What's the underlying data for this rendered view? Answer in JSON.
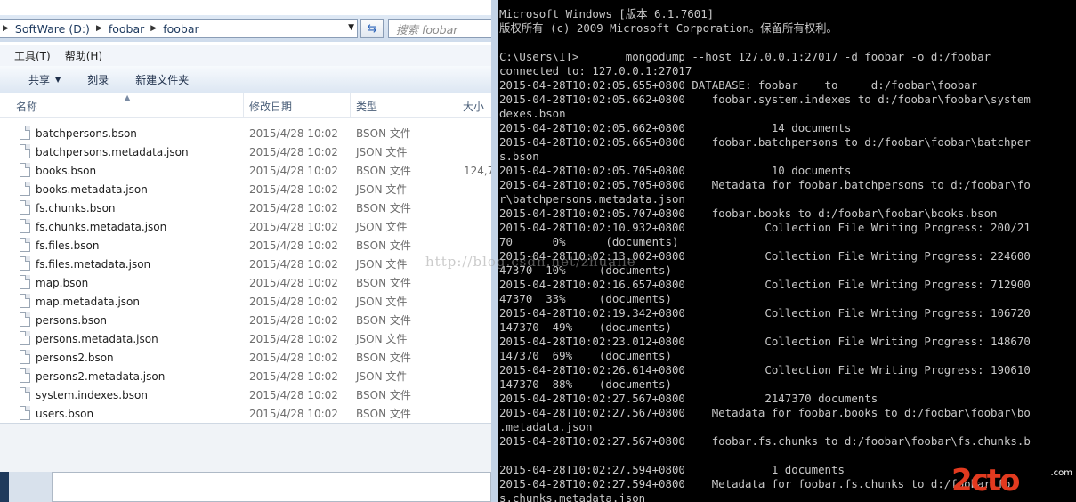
{
  "explorer": {
    "breadcrumb": [
      {
        "label": "SoftWare (D:)"
      },
      {
        "label": "foobar"
      },
      {
        "label": "foobar"
      }
    ],
    "search_placeholder": "搜索 foobar",
    "menu": [
      "工具(T)",
      "帮助(H)"
    ],
    "toolbar": {
      "share": "共享",
      "burn": "刻录",
      "new_folder": "新建文件夹"
    },
    "columns": {
      "name": "名称",
      "date": "修改日期",
      "type": "类型",
      "size": "大小"
    },
    "files": [
      {
        "name": "batchpersons.bson",
        "date": "2015/4/28 10:02",
        "type": "BSON 文件",
        "size": ""
      },
      {
        "name": "batchpersons.metadata.json",
        "date": "2015/4/28 10:02",
        "type": "JSON 文件",
        "size": ""
      },
      {
        "name": "books.bson",
        "date": "2015/4/28 10:02",
        "type": "BSON 文件",
        "size": "124,7"
      },
      {
        "name": "books.metadata.json",
        "date": "2015/4/28 10:02",
        "type": "JSON 文件",
        "size": ""
      },
      {
        "name": "fs.chunks.bson",
        "date": "2015/4/28 10:02",
        "type": "BSON 文件",
        "size": ""
      },
      {
        "name": "fs.chunks.metadata.json",
        "date": "2015/4/28 10:02",
        "type": "JSON 文件",
        "size": ""
      },
      {
        "name": "fs.files.bson",
        "date": "2015/4/28 10:02",
        "type": "BSON 文件",
        "size": ""
      },
      {
        "name": "fs.files.metadata.json",
        "date": "2015/4/28 10:02",
        "type": "JSON 文件",
        "size": ""
      },
      {
        "name": "map.bson",
        "date": "2015/4/28 10:02",
        "type": "BSON 文件",
        "size": ""
      },
      {
        "name": "map.metadata.json",
        "date": "2015/4/28 10:02",
        "type": "JSON 文件",
        "size": ""
      },
      {
        "name": "persons.bson",
        "date": "2015/4/28 10:02",
        "type": "BSON 文件",
        "size": ""
      },
      {
        "name": "persons.metadata.json",
        "date": "2015/4/28 10:02",
        "type": "JSON 文件",
        "size": ""
      },
      {
        "name": "persons2.bson",
        "date": "2015/4/28 10:02",
        "type": "BSON 文件",
        "size": ""
      },
      {
        "name": "persons2.metadata.json",
        "date": "2015/4/28 10:02",
        "type": "JSON 文件",
        "size": ""
      },
      {
        "name": "system.indexes.bson",
        "date": "2015/4/28 10:02",
        "type": "BSON 文件",
        "size": ""
      },
      {
        "name": "users.bson",
        "date": "2015/4/28 10:02",
        "type": "BSON 文件",
        "size": ""
      }
    ]
  },
  "console": {
    "lines": [
      "Microsoft Windows [版本 6.1.7601]",
      "版权所有 (c) 2009 Microsoft Corporation。保留所有权利。",
      "",
      "C:\\Users\\IT>       mongodump --host 127.0.0.1:27017 -d foobar -o d:/foobar",
      "connected to: 127.0.0.1:27017",
      "2015-04-28T10:02:05.655+0800 DATABASE: foobar    to     d:/foobar\\foobar",
      "2015-04-28T10:02:05.662+0800    foobar.system.indexes to d:/foobar\\foobar\\system",
      "dexes.bson",
      "2015-04-28T10:02:05.662+0800             14 documents",
      "2015-04-28T10:02:05.665+0800    foobar.batchpersons to d:/foobar\\foobar\\batchper",
      "s.bson",
      "2015-04-28T10:02:05.705+0800             10 documents",
      "2015-04-28T10:02:05.705+0800    Metadata for foobar.batchpersons to d:/foobar\\fo",
      "r\\batchpersons.metadata.json",
      "2015-04-28T10:02:05.707+0800    foobar.books to d:/foobar\\foobar\\books.bson",
      "2015-04-28T10:02:10.932+0800            Collection File Writing Progress: 200/21",
      "70      0%      (documents)",
      "2015-04-28T10:02:13.002+0800            Collection File Writing Progress: 224600",
      "47370  10%     (documents)",
      "2015-04-28T10:02:16.657+0800            Collection File Writing Progress: 712900",
      "47370  33%     (documents)",
      "2015-04-28T10:02:19.342+0800            Collection File Writing Progress: 106720",
      "147370  49%    (documents)",
      "2015-04-28T10:02:23.012+0800            Collection File Writing Progress: 148670",
      "147370  69%    (documents)",
      "2015-04-28T10:02:26.614+0800            Collection File Writing Progress: 190610",
      "147370  88%    (documents)",
      "2015-04-28T10:02:27.567+0800            2147370 documents",
      "2015-04-28T10:02:27.567+0800    Metadata for foobar.books to d:/foobar\\foobar\\bo",
      ".metadata.json",
      "2015-04-28T10:02:27.567+0800    foobar.fs.chunks to d:/foobar\\foobar\\fs.chunks.b",
      "",
      "2015-04-28T10:02:27.594+0800             1 documents",
      "2015-04-28T10:02:27.594+0800    Metadata for foobar.fs.chunks to d:/foobar\\fo",
      "s.chunks.metadata.json"
    ]
  },
  "watermark": "http://blog.csdn.net/zhuaiie",
  "logo": {
    "main": "2cto",
    "sub": ".com"
  }
}
